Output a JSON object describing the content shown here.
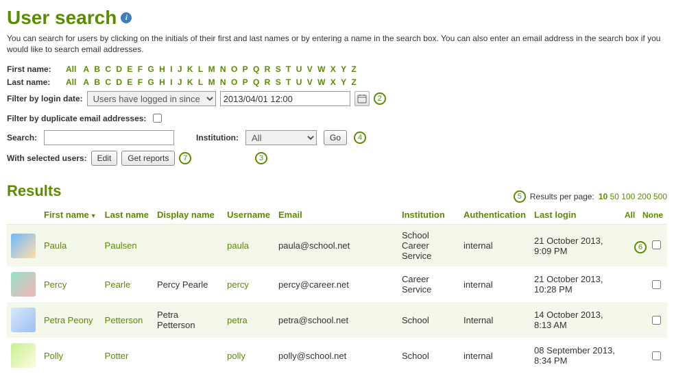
{
  "page": {
    "title": "User search",
    "intro": "You can search for users by clicking on the initials of their first and last names or by entering a name in the search box. You can also enter an email address in the search box if you would like to search email addresses."
  },
  "filters": {
    "first_name_label": "First name:",
    "last_name_label": "Last name:",
    "all_label": "All",
    "letters": [
      "A",
      "B",
      "C",
      "D",
      "E",
      "F",
      "G",
      "H",
      "I",
      "J",
      "K",
      "L",
      "M",
      "N",
      "O",
      "P",
      "Q",
      "R",
      "S",
      "T",
      "U",
      "V",
      "W",
      "X",
      "Y",
      "Z"
    ],
    "login_date_label": "Filter by login date:",
    "login_date_select_options": [
      "Users have logged in since"
    ],
    "login_date_selected": "Users have logged in since",
    "login_date_value": "2013/04/01 12:00",
    "dup_email_label": "Filter by duplicate email addresses:",
    "dup_email_checked": false,
    "search_label": "Search:",
    "search_value": "",
    "institution_label": "Institution:",
    "institution_options": [
      "All"
    ],
    "institution_selected": "All",
    "go_label": "Go",
    "with_selected_label": "With selected users:",
    "edit_label": "Edit",
    "reports_label": "Get reports"
  },
  "annotations": {
    "2": "2",
    "3": "3",
    "4": "4",
    "5": "5",
    "6": "6",
    "7": "7"
  },
  "results": {
    "heading": "Results",
    "rpp_label": "Results per page:",
    "rpp_options": [
      "10",
      "50",
      "100",
      "200",
      "500"
    ],
    "rpp_selected": "10",
    "columns": {
      "first_name": "First name",
      "last_name": "Last name",
      "display_name": "Display name",
      "username": "Username",
      "email": "Email",
      "institution": "Institution",
      "authentication": "Authentication",
      "last_login": "Last login",
      "select_all": "All",
      "select_none": "None"
    },
    "sort": {
      "column": "first_name",
      "dir": "asc"
    },
    "rows": [
      {
        "avatar_class": "av1",
        "first_name": "Paula",
        "last_name": "Paulsen",
        "display_name": "",
        "username": "paula",
        "email": "paula@school.net",
        "institution": "School\nCareer Service",
        "authentication": "internal",
        "last_login": "21 October 2013, 9:09 PM",
        "selected": false
      },
      {
        "avatar_class": "av2",
        "first_name": "Percy",
        "last_name": "Pearle",
        "display_name": "Percy Pearle",
        "username": "percy",
        "email": "percy@career.net",
        "institution": "Career Service",
        "authentication": "internal",
        "last_login": "21 October 2013, 10:28 PM",
        "selected": false
      },
      {
        "avatar_class": "av3",
        "first_name": "Petra Peony",
        "last_name": "Petterson",
        "display_name": "Petra Petterson",
        "username": "petra",
        "email": "petra@school.net",
        "institution": "School",
        "authentication": "Internal",
        "last_login": "14 October 2013, 8:13 AM",
        "selected": false
      },
      {
        "avatar_class": "av4",
        "first_name": "Polly",
        "last_name": "Potter",
        "display_name": "",
        "username": "polly",
        "email": "polly@school.net",
        "institution": "School",
        "authentication": "internal",
        "last_login": "08 September 2013, 8:34 PM",
        "selected": false
      }
    ]
  }
}
